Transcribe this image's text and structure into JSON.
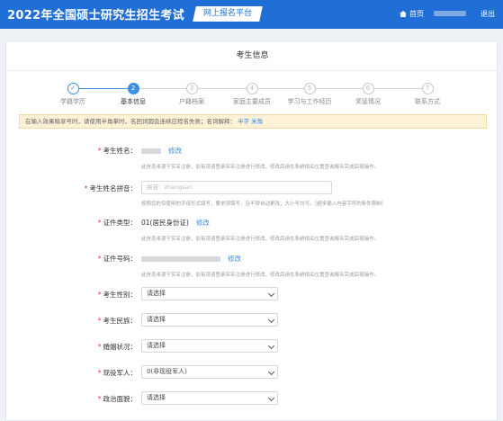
{
  "header": {
    "title": "2022年全国硕士研究生招生考试",
    "platform": "网上报名平台",
    "home": "首页",
    "logout": "退出"
  },
  "page_title": "考生信息",
  "steps": [
    {
      "label": "学籍学历",
      "num": "✓",
      "state": "done"
    },
    {
      "label": "基本信息",
      "num": "2",
      "state": "active"
    },
    {
      "label": "户籍档案",
      "num": "3",
      "state": "todo"
    },
    {
      "label": "家庭主要成员",
      "num": "4",
      "state": "todo"
    },
    {
      "label": "学习与工作经历",
      "num": "5",
      "state": "todo"
    },
    {
      "label": "奖惩情况",
      "num": "6",
      "state": "todo"
    },
    {
      "label": "联系方式",
      "num": "7",
      "state": "todo"
    }
  ],
  "notice": {
    "text": "在输入效果暗享号时，请使用半角掌时，名回词圆会连续应程名失败；名词解释：",
    "link1": "半字",
    "link2": "米角"
  },
  "fields": {
    "name": {
      "label": "考生姓名：",
      "edit": "修改",
      "hint": "此信息来源于实名注册，如有误请登录实名注册进行修改，修改后请在系统相关位置查询报名完成后按操作。"
    },
    "pinyin": {
      "label": "考生姓名拼音：",
      "placeholder": "拼音：zhangsan",
      "hint": "按照您的仅使用的字母形式填写，要求须填写，且不得自动更改，大小写均可。（超多输入内容字符的条件限制）"
    },
    "id_type": {
      "label": "证件类型：",
      "value": "01(居民身份证)",
      "edit": "修改",
      "hint": "此信息来源于实名注册，如有误请登录实名注册进行修改，修改后请在系统相关位置查询报名完成后按操作。"
    },
    "id_number": {
      "label": "证件号码：",
      "edit": "修改",
      "hint": "此信息来源于实名注册，如有误请登录实名注册进行修改，修改后请在系统相关位置查询报名完成后按操作。"
    },
    "gender": {
      "label": "考生性别：",
      "value": "请选择"
    },
    "ethnicity": {
      "label": "考生民族：",
      "value": "请选择"
    },
    "marital": {
      "label": "婚姻状况：",
      "value": "请选择"
    },
    "military": {
      "label": "现役军人：",
      "value": "0(非现役军人)"
    },
    "political": {
      "label": "政治面貌：",
      "value": "请选择"
    }
  }
}
